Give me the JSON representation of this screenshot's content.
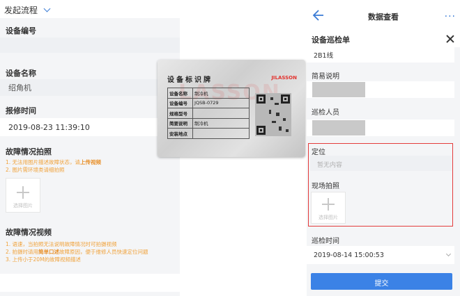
{
  "left_form": {
    "flow_title": "发起流程",
    "device_number_label": "设备编号",
    "device_name_label": "设备名称",
    "device_name_value": "绍角机",
    "report_time_label": "报修时间",
    "report_time_value": "2019-08-23 11:39:10",
    "fault_photo_label": "故障情况拍照",
    "fault_photo_hints": [
      {
        "pre": "1. 无法用图片描述故障状态，请",
        "strong": "上传视频",
        "post": ""
      },
      {
        "pre": "2. 图片需环境类请细拍照",
        "strong": "",
        "post": ""
      }
    ],
    "upload_caption": "选择图片",
    "fault_video_label": "故障情况视频",
    "fault_video_hints": [
      {
        "pre": "1. 语速，当拍照无法说明故障情况时可拍摄视频",
        "strong": "",
        "post": ""
      },
      {
        "pre": "2. 拍摄时请用",
        "strong": "简单口述",
        "post": "故障原因，便于维修人员快速定位问题"
      },
      {
        "pre": "3. 上传小于20M的故障视频描述",
        "strong": "",
        "post": ""
      }
    ]
  },
  "nameplate": {
    "title": "设备标识牌",
    "brand": "JILASSON",
    "watermark": "LASSON",
    "rows": [
      {
        "key": "设备名称",
        "value": "制冷机"
      },
      {
        "key": "设备编号",
        "value": "JQSB-0729"
      },
      {
        "key": "规格型号",
        "value": ""
      },
      {
        "key": "简要说明",
        "value": "制冷机"
      },
      {
        "key": "安装地点",
        "value": ""
      }
    ]
  },
  "phone": {
    "nav_title": "数据查看",
    "more_label": "···",
    "panel_title": "设备巡检单",
    "line_value": "2B1线",
    "brief_label": "简易说明",
    "inspector_label": "巡检人员",
    "location_label": "定位",
    "location_placeholder": "暂无内容",
    "photo_label": "现场拍照",
    "upload_caption": "选择图片",
    "inspect_time_label": "巡检时间",
    "inspect_time_value": "2019-08-14 15:00:53",
    "submit_label": "提交"
  },
  "colors": {
    "accent": "#3b82e6",
    "hint": "#f0a23b",
    "highlight_frame": "#e43b3b"
  }
}
